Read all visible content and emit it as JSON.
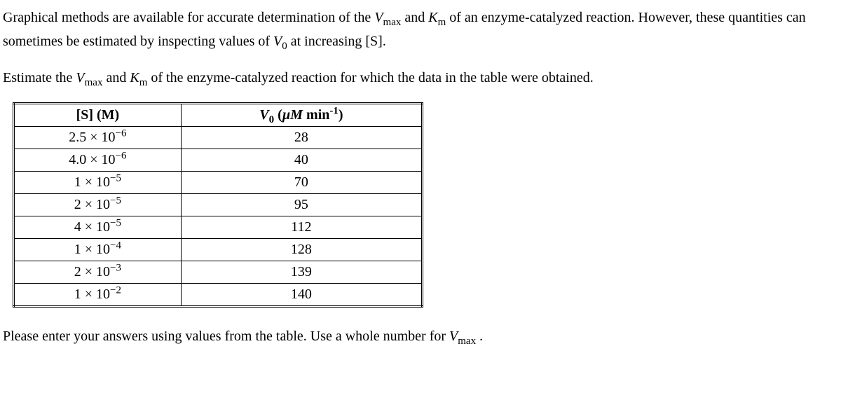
{
  "intro": {
    "sentence1_part1": "Graphical methods are available for accurate determination of the ",
    "vmax_v": "V",
    "vmax_sub": "max",
    "sentence1_part2": " and ",
    "km_k": "K",
    "km_sub": "m",
    "sentence1_part3": " of an enzyme-catalyzed reaction. However, these quantities can sometimes be estimated by inspecting values of ",
    "v0_v": "V",
    "v0_sub": "0",
    "sentence1_part4": " at increasing [S]."
  },
  "prompt": {
    "part1": "Estimate the ",
    "vmax_v": "V",
    "vmax_sub": "max",
    "part2": " and ",
    "km_k": "K",
    "km_sub": "m",
    "part3": " of the enzyme-catalyzed reaction for which the data in the table were obtained."
  },
  "table": {
    "header_s": "[S] (M)",
    "header_v_v": "V",
    "header_v_sub": "0",
    "header_v_open": " (",
    "header_v_unit": "µM",
    "header_v_part3": " min",
    "header_v_sup": "-1",
    "header_v_close": ")",
    "rows": [
      {
        "s_coeff": "2.5 × 10",
        "s_exp": "−6",
        "v": "28"
      },
      {
        "s_coeff": "4.0 × 10",
        "s_exp": "−6",
        "v": "40"
      },
      {
        "s_coeff": "1 × 10",
        "s_exp": "−5",
        "v": "70"
      },
      {
        "s_coeff": "2 × 10",
        "s_exp": "−5",
        "v": "95"
      },
      {
        "s_coeff": "4 × 10",
        "s_exp": "−5",
        "v": "112"
      },
      {
        "s_coeff": "1 × 10",
        "s_exp": "−4",
        "v": "128"
      },
      {
        "s_coeff": "2 × 10",
        "s_exp": "−3",
        "v": "139"
      },
      {
        "s_coeff": "1 × 10",
        "s_exp": "−2",
        "v": "140"
      }
    ]
  },
  "instruction": {
    "part1": "Please enter your answers using values from the table. Use a whole number for ",
    "vmax_v": "V",
    "vmax_sub": "max",
    "part2": " ."
  }
}
